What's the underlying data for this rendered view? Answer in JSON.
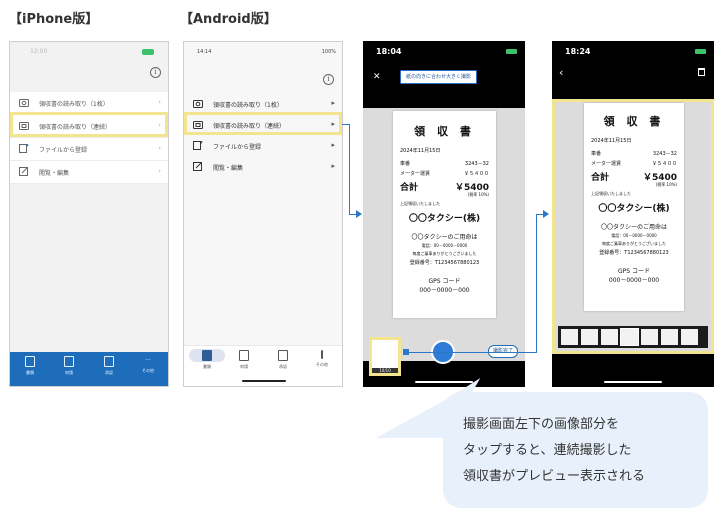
{
  "labels": {
    "iphone": "【iPhone版】",
    "android": "【Android版】"
  },
  "iphone": {
    "menu": [
      {
        "label": "領収書の読み取り（1枚）"
      },
      {
        "label": "領収書の読み取り（連続）"
      },
      {
        "label": "ファイルから登録"
      },
      {
        "label": "閲覧・編集"
      }
    ],
    "tabs": [
      "書類",
      "申請",
      "承認",
      "その他"
    ]
  },
  "android": {
    "time": "14:14",
    "signal": "100%",
    "menu": [
      {
        "label": "領収書の読み取り（1枚）"
      },
      {
        "label": "領収書の読み取り（連続）"
      },
      {
        "label": "ファイルから登録"
      },
      {
        "label": "閲覧・編集"
      }
    ],
    "tabs": [
      "書類",
      "申請",
      "承認",
      "その他"
    ]
  },
  "camera": {
    "time": "18:04",
    "fit_button": "紙の向きに合わせ大きく撮影",
    "counter": "10/10",
    "done_button": "撮影完了"
  },
  "preview": {
    "time": "18:24"
  },
  "receipt": {
    "title": "領 収 書",
    "date": "2024年11月15日",
    "car_label": "車番",
    "car_no": "3243－32",
    "meter_label": "メーター運賃",
    "meter_value": "￥５４００",
    "total_label": "合計",
    "total_value": "￥5400",
    "tax": "(税率 10%)",
    "received": "上記領収いたしました",
    "company": "〇〇タクシー(株)",
    "thanks": "〇〇タクシーのご用命は",
    "phone": "電話：00－0000－0000",
    "daily": "毎度ご乗車ありがとうございました",
    "reg": "登録番号：T1234567880123",
    "gps_label": "GPS コード",
    "gps_code": "000－0000－000"
  },
  "callout": {
    "line1": "撮影画面左下の画像部分を",
    "line2": "タップすると、連続撮影した",
    "line3": "領収書がプレビュー表示される"
  },
  "colors": {
    "accent": "#1d6dbb",
    "highlight": "#f3e48f",
    "callout_bg": "#e8f1fb"
  }
}
